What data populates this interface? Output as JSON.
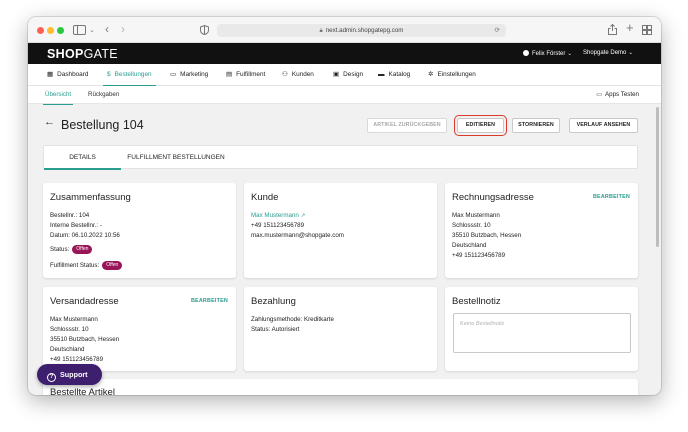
{
  "browser": {
    "url": "next.admin.shopgatepg.com"
  },
  "header": {
    "logo_shop": "SHOP",
    "logo_gate": "GATE",
    "user": "Felix Förster",
    "shop": "Shopgate Demo"
  },
  "nav": {
    "items": [
      {
        "label": "Dashboard",
        "icon": "dashboard-icon"
      },
      {
        "label": "Bestellungen",
        "icon": "dollar-icon"
      },
      {
        "label": "Marketing",
        "icon": "chat-icon"
      },
      {
        "label": "Fulfillment",
        "icon": "clipboard-icon"
      },
      {
        "label": "Kunden",
        "icon": "people-icon"
      },
      {
        "label": "Design",
        "icon": "design-icon"
      },
      {
        "label": "Katalog",
        "icon": "catalog-icon"
      },
      {
        "label": "Einstellungen",
        "icon": "gear-icon"
      }
    ],
    "active": "Bestellungen"
  },
  "subnav": {
    "items": [
      "Übersicht",
      "Rückgaben"
    ],
    "apps_test": "Apps Testen"
  },
  "page": {
    "title": "Bestellung 104",
    "buttons": {
      "artikel_zurueckgeben": "ARTIKEL ZURÜCKGEBEN",
      "editieren": "EDITIEREN",
      "stornieren": "STORNIEREN",
      "verlauf": "VERLAUF ANSEHEN"
    },
    "tabs": [
      "DETAILS",
      "FULFILLMENT BESTELLUNGEN"
    ]
  },
  "summary": {
    "title": "Zusammenfassung",
    "order_no": "Bestellnr.: 104",
    "internal_no": "Interne Bestellnr.: -",
    "date": "Datum: 06.10.2022 10:56",
    "status_label": "Status:",
    "status_value": "Offen",
    "fulfillment_label": "Fulfillment Status:",
    "fulfillment_value": "Offen"
  },
  "customer": {
    "title": "Kunde",
    "name": "Max Mustermann",
    "phone": "+49 151123456789",
    "email": "max.mustermann@shopgate.com"
  },
  "billing": {
    "title": "Rechnungsadresse",
    "edit": "BEARBEITEN",
    "lines": [
      "Max Mustermann",
      "Schlossstr. 10",
      "35510 Butzbach, Hessen",
      "Deutschland",
      "+49 151123456789"
    ]
  },
  "shipping": {
    "title": "Versandadresse",
    "edit": "BEARBEITEN",
    "lines": [
      "Max Mustermann",
      "Schlossstr. 10",
      "35510 Butzbach, Hessen",
      "Deutschland",
      "+49 151123456789"
    ]
  },
  "payment": {
    "title": "Bezahlung",
    "method": "Zahlungsmethode: Kreditkarte",
    "status": "Status: Autorisiert"
  },
  "note": {
    "title": "Bestellnotiz",
    "placeholder": "Keine Bestellnotiz"
  },
  "ordered_items": {
    "title": "Bestellte Artikel"
  },
  "support": {
    "label": "Support"
  },
  "colors": {
    "accent": "#2a9d8f",
    "badge": "#9a1458",
    "highlight": "#d93a2b",
    "support": "#3d1f6e"
  }
}
